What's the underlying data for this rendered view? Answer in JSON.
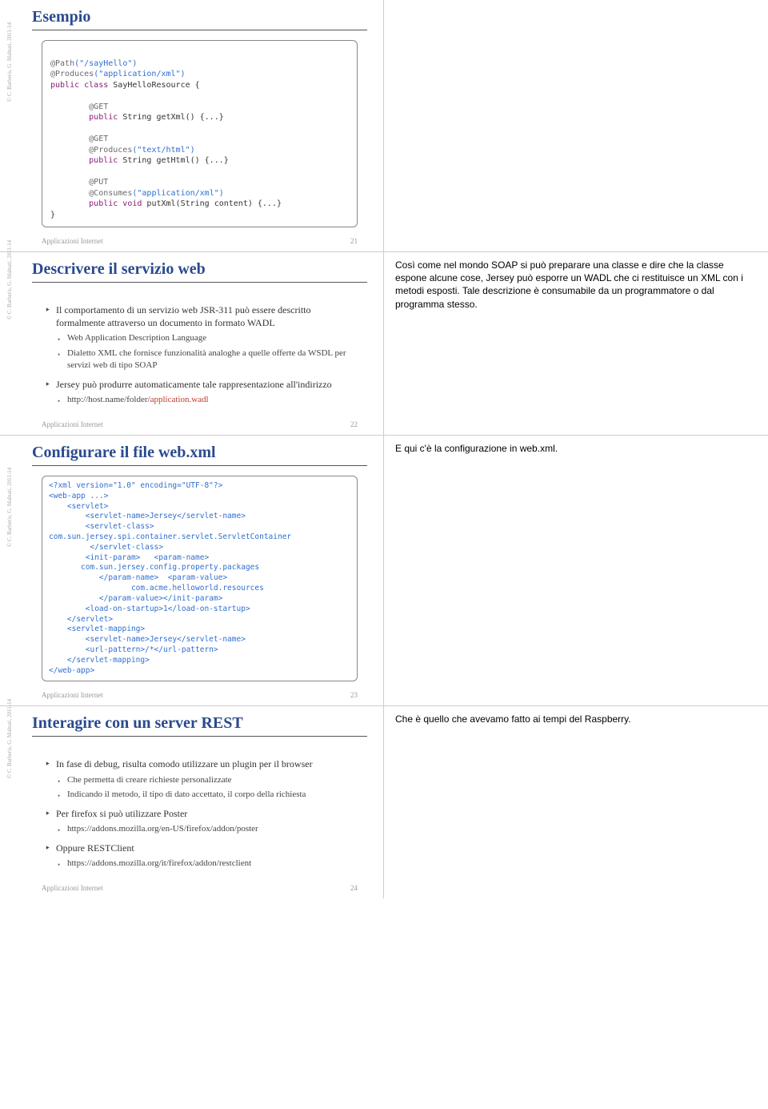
{
  "common": {
    "footer": "Applicazioni Internet",
    "credit": "© C. Barberis, G. Malnati, 2011-14"
  },
  "slide21": {
    "title": "Esempio",
    "page": "21",
    "code": {
      "l1a": "@Path",
      "l1b": "(\"/sayHello\")",
      "l2a": "@Produces",
      "l2b": "(\"application/xml\")",
      "l3a": "public class ",
      "l3b": "SayHelloResource {",
      "l4": "",
      "l5a": "        @GET",
      "l6a": "        public ",
      "l6b": "String getXml() {...}",
      "l7": "",
      "l8a": "        @GET",
      "l9a": "        @Produces",
      "l9b": "(\"text/html\")",
      "l10a": "        public ",
      "l10b": "String getHtml() {...}",
      "l11": "",
      "l12a": "        @PUT",
      "l13a": "        @Consumes",
      "l13b": "(\"application/xml\")",
      "l14a": "        public void ",
      "l14b": "putXml(String content) {...}",
      "l15": "}"
    }
  },
  "slide22": {
    "title": "Descrivere il servizio web",
    "page": "22",
    "b1": "Il comportamento di un servizio web JSR-311 può essere descritto formalmente attraverso un documento in formato WADL",
    "b1a": "Web Application Description Language",
    "b1b": "Dialetto XML che fornisce funzionalità analoghe a quelle offerte da WSDL per servizi web di tipo SOAP",
    "b2": "Jersey può produrre automaticamente tale rappresentazione all'indirizzo",
    "b2a_pre": "http://host.name/folder/",
    "b2a_red": "application.wadl",
    "note": "Così come nel mondo SOAP si può preparare una classe e dire che la classe espone alcune cose, Jersey può esporre un WADL che ci restituisce un XML con i metodi esposti. Tale descrizione è consumabile da un programmatore o dal programma stesso."
  },
  "slide23": {
    "title": "Configurare il file web.xml",
    "page": "23",
    "note": "E qui c'è la configurazione in web.xml.",
    "xmlcode": "<?xml version=\"1.0\" encoding=\"UTF-8\"?>\n<web-app ...>\n    <servlet>\n        <servlet-name>Jersey</servlet-name>\n        <servlet-class>\ncom.sun.jersey.spi.container.servlet.ServletContainer\n         </servlet-class>\n        <init-param>   <param-name>\n       com.sun.jersey.config.property.packages\n           </param-name>  <param-value>\n                  com.acme.helloworld.resources\n           </param-value></init-param>\n        <load-on-startup>1</load-on-startup>\n    </servlet>\n    <servlet-mapping>\n        <servlet-name>Jersey</servlet-name>\n        <url-pattern>/*</url-pattern>\n    </servlet-mapping>\n</web-app>"
  },
  "slide24": {
    "title": "Interagire con un server REST",
    "page": "24",
    "note": "Che è quello che avevamo fatto ai tempi del Raspberry.",
    "b1": "In fase di debug, risulta comodo utilizzare un plugin per il browser",
    "b1a": "Che permetta di creare richieste personalizzate",
    "b1b": "Indicando il metodo, il tipo di dato accettato, il corpo della richiesta",
    "b2": "Per firefox si può utilizzare Poster",
    "b2a": "https://addons.mozilla.org/en-US/firefox/addon/poster",
    "b3": "Oppure RESTClient",
    "b3a": "https://addons.mozilla.org/it/firefox/addon/restclient"
  }
}
